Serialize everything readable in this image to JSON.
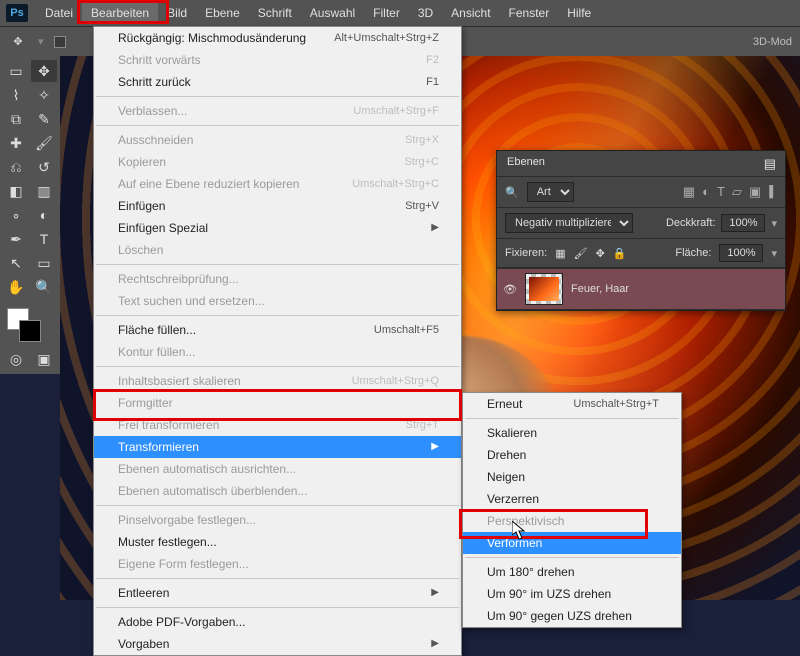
{
  "app": {
    "logo": "Ps"
  },
  "menubar": [
    "Datei",
    "Bearbeiten",
    "Bild",
    "Ebene",
    "Schrift",
    "Auswahl",
    "Filter",
    "3D",
    "Ansicht",
    "Fenster",
    "Hilfe"
  ],
  "optbar": {
    "label_3d": "3D-Mod"
  },
  "edit_menu": {
    "groups": [
      [
        {
          "label": "Rückgängig: Mischmodusänderung",
          "sc": "Alt+Umschalt+Strg+Z"
        },
        {
          "label": "Schritt vorwärts",
          "sc": "F2",
          "disabled": true
        },
        {
          "label": "Schritt zurück",
          "sc": "F1"
        }
      ],
      [
        {
          "label": "Verblassen...",
          "sc": "Umschalt+Strg+F",
          "disabled": true
        }
      ],
      [
        {
          "label": "Ausschneiden",
          "sc": "Strg+X",
          "disabled": true
        },
        {
          "label": "Kopieren",
          "sc": "Strg+C",
          "disabled": true
        },
        {
          "label": "Auf eine Ebene reduziert kopieren",
          "sc": "Umschalt+Strg+C",
          "disabled": true
        },
        {
          "label": "Einfügen",
          "sc": "Strg+V"
        },
        {
          "label": "Einfügen Spezial",
          "sub": true
        },
        {
          "label": "Löschen",
          "disabled": true
        }
      ],
      [
        {
          "label": "Rechtschreibprüfung...",
          "disabled": true
        },
        {
          "label": "Text suchen und ersetzen...",
          "disabled": true
        }
      ],
      [
        {
          "label": "Fläche füllen...",
          "sc": "Umschalt+F5"
        },
        {
          "label": "Kontur füllen...",
          "disabled": true
        }
      ],
      [
        {
          "label": "Inhaltsbasiert skalieren",
          "sc": "Umschalt+Strg+Q",
          "disabled": true
        },
        {
          "label": "Formgitter",
          "disabled": true
        },
        {
          "label": "Frei transformieren",
          "sc": "Strg+T",
          "disabled": true
        },
        {
          "label": "Transformieren",
          "sub": true,
          "hover": true
        },
        {
          "label": "Ebenen automatisch ausrichten...",
          "disabled": true
        },
        {
          "label": "Ebenen automatisch überblenden...",
          "disabled": true
        }
      ],
      [
        {
          "label": "Pinselvorgabe festlegen...",
          "disabled": true
        },
        {
          "label": "Muster festlegen..."
        },
        {
          "label": "Eigene Form festlegen...",
          "disabled": true
        }
      ],
      [
        {
          "label": "Entleeren",
          "sub": true
        }
      ],
      [
        {
          "label": "Adobe PDF-Vorgaben..."
        },
        {
          "label": "Vorgaben",
          "sub": true
        }
      ]
    ]
  },
  "transform_menu": {
    "groups": [
      [
        {
          "label": "Erneut",
          "sc": "Umschalt+Strg+T"
        }
      ],
      [
        {
          "label": "Skalieren"
        },
        {
          "label": "Drehen"
        },
        {
          "label": "Neigen"
        },
        {
          "label": "Verzerren"
        },
        {
          "label": "Perspektivisch",
          "disabled": true
        },
        {
          "label": "Verformen",
          "hover": true
        }
      ],
      [
        {
          "label": "Um 180° drehen"
        },
        {
          "label": "Um 90° im UZS drehen"
        },
        {
          "label": "Um 90° gegen UZS drehen"
        }
      ]
    ]
  },
  "panel": {
    "title": "Ebenen",
    "filter": "Art",
    "blend": "Negativ multiplizieren",
    "opacity_label": "Deckkraft:",
    "opacity": "100%",
    "lock_label": "Fixieren:",
    "fill_label": "Fläche:",
    "fill": "100%",
    "layer_name": "Feuer, Haar"
  }
}
